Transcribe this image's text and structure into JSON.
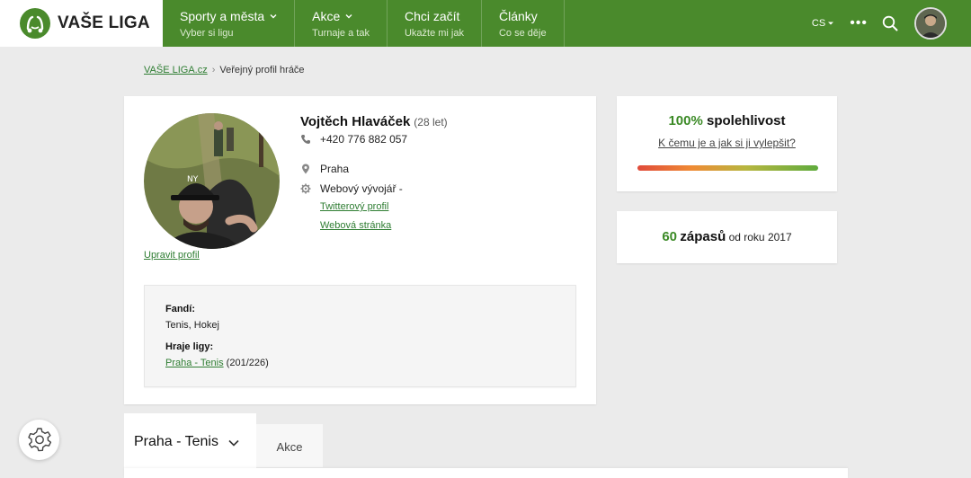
{
  "brand": {
    "name": "VAŠE LIGA"
  },
  "nav": [
    {
      "title": "Sporty a města",
      "sub": "Vyber si ligu",
      "dropdown": true
    },
    {
      "title": "Akce",
      "sub": "Turnaje a tak",
      "dropdown": true
    },
    {
      "title": "Chci začít",
      "sub": "Ukažte mi jak",
      "dropdown": false
    },
    {
      "title": "Články",
      "sub": "Co se děje",
      "dropdown": false
    }
  ],
  "tools": {
    "lang": "CS",
    "more": "•••"
  },
  "breadcrumb": {
    "home": "VAŠE LIGA.cz",
    "current": "Veřejný profil hráče"
  },
  "profile": {
    "name": "Vojtěch Hlaváček",
    "age": "(28 let)",
    "phone": "+420 776 882 057",
    "city": "Praha",
    "job": "Webový vývojář -",
    "twitter_link": "Twitterový profil",
    "web_link": "Webová stránka",
    "edit_link": "Upravit profil",
    "fans_label": "Fandí:",
    "fans_value": "Tenis, Hokej",
    "leagues_label": "Hraje ligy:",
    "league_link": "Praha - Tenis",
    "league_rank": "(201/226)"
  },
  "reliability": {
    "percent": "100%",
    "label": "spolehlivost",
    "link": "K čemu je a jak si ji vylepšit?",
    "level": 1.0
  },
  "matches": {
    "count": "60",
    "word": "zápasů",
    "since": "od roku 2017"
  },
  "tabs": {
    "league": "Praha - Tenis",
    "akce": "Akce"
  },
  "colors": {
    "brand_green": "#4a8a2c",
    "accent_green": "#3b8a26",
    "link_green": "#2e7d32"
  }
}
